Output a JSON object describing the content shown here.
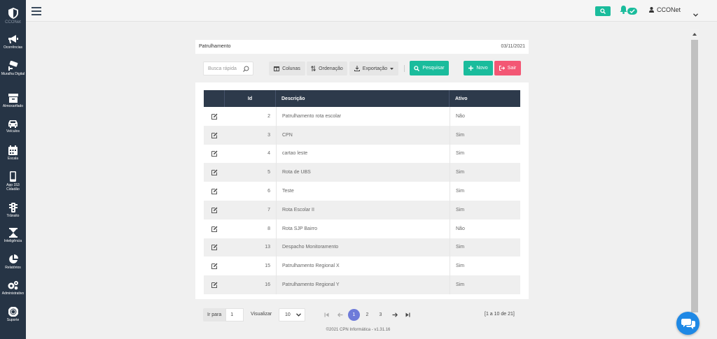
{
  "app": {
    "logo_label": "CCONet"
  },
  "sidebar": {
    "items": [
      {
        "label": "Ocorrências",
        "icon": "megaphone-icon"
      },
      {
        "label": "Muralha Digital",
        "icon": "cctv-icon"
      },
      {
        "label": "Almoxarifado",
        "icon": "archive-icon"
      },
      {
        "label": "Veículos",
        "icon": "car-icon"
      },
      {
        "label": "Escala",
        "icon": "calendar-icon"
      },
      {
        "label": "App 153 Cidadão",
        "icon": "mobile-icon"
      },
      {
        "label": "Trânsito",
        "icon": "traffic-light-icon"
      },
      {
        "label": "Inteligência",
        "icon": "hourglass-icon"
      },
      {
        "label": "Relatórios",
        "icon": "pie-chart-icon"
      },
      {
        "label": "Administrativo",
        "icon": "cogs-icon"
      },
      {
        "label": "Suporte",
        "icon": "lifebuoy-icon"
      }
    ]
  },
  "topbar": {
    "user_name": "CCONet"
  },
  "page": {
    "title": "Patrulhamento",
    "date": "03/11/2021"
  },
  "toolbar": {
    "quick_search_placeholder": "Busca rápida",
    "columns_label": "Colunas",
    "ordering_label": "Ordenação",
    "export_label": "Exportação",
    "search_label": "Pesquisar",
    "new_label": "Novo",
    "exit_label": "Sair"
  },
  "table": {
    "headers": {
      "id": "Id",
      "description": "Descrição",
      "active": "Ativo"
    },
    "rows": [
      {
        "id": "2",
        "description": "Patrulhamento rota escolar",
        "active": "Não"
      },
      {
        "id": "3",
        "description": "CPN",
        "active": "Sim"
      },
      {
        "id": "4",
        "description": "cartao leste",
        "active": "Sim"
      },
      {
        "id": "5",
        "description": "Rota de UBS",
        "active": "Sim"
      },
      {
        "id": "6",
        "description": "Teste",
        "active": "Sim"
      },
      {
        "id": "7",
        "description": "Rota Escolar II",
        "active": "Sim"
      },
      {
        "id": "8",
        "description": "Rota SJP Bairro",
        "active": "Não"
      },
      {
        "id": "13",
        "description": "Despacho Monitoramento",
        "active": "Sim"
      },
      {
        "id": "15",
        "description": "Patrulhamento Regional X",
        "active": "Sim"
      },
      {
        "id": "16",
        "description": "Patrulhamento Regional Y",
        "active": "Sim"
      }
    ]
  },
  "pagination": {
    "goto_label": "Ir para",
    "goto_value": "1",
    "view_label": "Visualizar",
    "per_page": "10",
    "pages": [
      "1",
      "2",
      "3"
    ],
    "current_page": "1",
    "range_text": "[1 a 10 de 21]"
  },
  "footer": {
    "text": "©2021 CPN Informática - v1.31.16"
  },
  "colors": {
    "accent": "#1abc9c",
    "danger": "#f35774",
    "sidebar": "#263445",
    "table_header": "#2d3a4b",
    "page_active": "#6e7bd9"
  }
}
